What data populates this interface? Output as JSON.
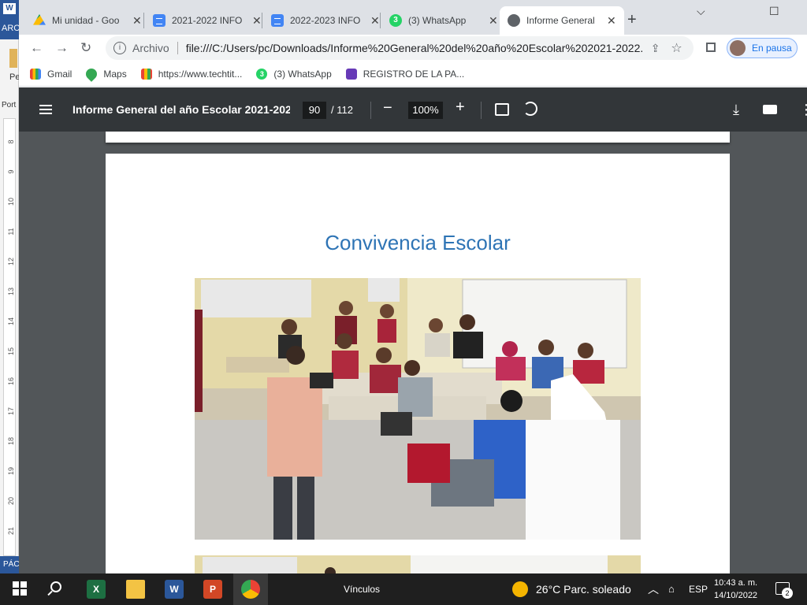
{
  "word": {
    "app_letter": "W",
    "ribbon_text": "ARC",
    "pe_text": "Pe",
    "por_text": "Port",
    "ruler_numbers": [
      "8",
      "9",
      "10",
      "11",
      "12",
      "13",
      "14",
      "15",
      "16",
      "17",
      "18",
      "19",
      "20",
      "21"
    ],
    "page_label": "PÁC"
  },
  "tabs": [
    {
      "title": "Mi unidad - Goo",
      "icon": "google-drive-icon"
    },
    {
      "title": "2021-2022 INFO",
      "icon": "google-docs-icon"
    },
    {
      "title": "2022-2023 INFO",
      "icon": "google-docs-icon"
    },
    {
      "title": "(3) WhatsApp",
      "icon": "whatsapp-icon"
    },
    {
      "title": "Informe General",
      "icon": "globe-icon",
      "active": true
    }
  ],
  "window_controls": {
    "minimize": "⌵",
    "maximize": "☐",
    "new_tab": "+"
  },
  "omnibox": {
    "scheme_label": "Archivo",
    "url": "file:///C:/Users/pc/Downloads/Informe%20General%20del%20año%20Escolar%202021-2022..."
  },
  "profile": {
    "label": "En pausa"
  },
  "bookmarks": [
    {
      "label": "Gmail",
      "icon": "gmail-icon"
    },
    {
      "label": "Maps",
      "icon": "maps-icon"
    },
    {
      "label": "https://www.techtit...",
      "icon": "grid-icon"
    },
    {
      "label": "(3) WhatsApp",
      "icon": "whatsapp-icon"
    },
    {
      "label": "REGISTRO DE LA PA...",
      "icon": "forms-icon"
    }
  ],
  "pdf": {
    "title": "Informe General del año Escolar 2021-2022...",
    "current_page": "90",
    "total_pages": "/ 112",
    "zoom": "100%"
  },
  "document": {
    "heading": "Convivencia Escolar"
  },
  "taskbar": {
    "vinculos": "Vínculos",
    "weather": "26°C  Parc. soleado",
    "language": "ESP",
    "time": "10:43 a. m.",
    "date": "14/10/2022",
    "notifications": "2",
    "excel_letter": "X",
    "word_letter": "W",
    "ppt_letter": "P"
  },
  "colors": {
    "heading_blue": "#2e74b5",
    "pdf_toolbar": "#323639",
    "pdf_background": "#525659",
    "tabstrip": "#dee1e6"
  }
}
